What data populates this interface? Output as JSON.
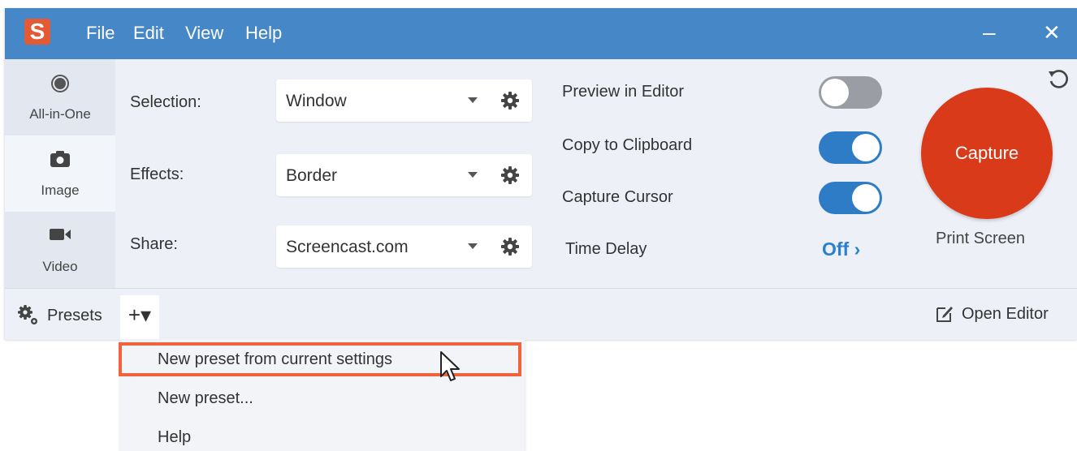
{
  "app": {
    "logo_letter": "S",
    "brand_color": "#e35a34",
    "titlebar_color": "#4687c8"
  },
  "menubar": [
    "File",
    "Edit",
    "View",
    "Help"
  ],
  "window_controls": {
    "minimize": "–",
    "close": "✕"
  },
  "capture_types": [
    {
      "label": "All-in-One",
      "icon": "record-circle-icon"
    },
    {
      "label": "Image",
      "icon": "camera-icon"
    },
    {
      "label": "Video",
      "icon": "video-camera-icon"
    }
  ],
  "settings": {
    "selection": {
      "label": "Selection:",
      "value": "Window"
    },
    "effects": {
      "label": "Effects:",
      "value": "Border"
    },
    "share": {
      "label": "Share:",
      "value": "Screencast.com"
    }
  },
  "options": {
    "preview_in_editor": {
      "label": "Preview in Editor",
      "on": false
    },
    "copy_to_clipboard": {
      "label": "Copy to Clipboard",
      "on": true
    },
    "capture_cursor": {
      "label": "Capture Cursor",
      "on": true
    },
    "time_delay": {
      "label": "Time Delay",
      "value": "Off ›"
    }
  },
  "capture": {
    "button_label": "Capture",
    "hotkey": "Print Screen",
    "color": "#d83a1a"
  },
  "bottom": {
    "presets_label": "Presets",
    "add_label": "+▾",
    "open_editor_label": "Open Editor"
  },
  "dropdown_menu": {
    "items": [
      "New preset from current settings",
      "New preset...",
      "Help"
    ],
    "highlight_color": "#f0633c"
  }
}
